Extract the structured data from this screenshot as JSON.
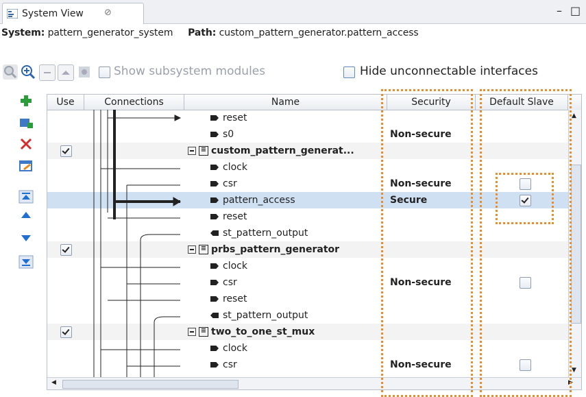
{
  "tab": {
    "title": "System View",
    "close": "⊘"
  },
  "window": {
    "minimize": "–",
    "maximize": "□"
  },
  "header": {
    "system_label": "System:",
    "system_value": "pattern_generator_system",
    "path_label": "Path:",
    "path_value": "custom_pattern_generator.pattern_access"
  },
  "toolbar": {
    "show_subsystem": {
      "label": "Show subsystem modules",
      "checked": false
    },
    "hide_unconnectable": {
      "label": "Hide unconnectable interfaces",
      "checked": false
    }
  },
  "columns": [
    "Use",
    "Connections",
    "Name",
    "Security",
    "Default Slave"
  ],
  "rows": [
    {
      "name": "reset",
      "kind": "pin",
      "security": "",
      "default": null,
      "trunc": "R"
    },
    {
      "name": "s0",
      "kind": "pin",
      "security": "Non-secure",
      "default": null,
      "trunc": "A"
    },
    {
      "name": "custom_pattern_generat...",
      "kind": "module",
      "use": true,
      "security": "",
      "default": null,
      "trunc": "C"
    },
    {
      "name": "clock",
      "kind": "pin",
      "security": "",
      "default": null,
      "trunc": "C"
    },
    {
      "name": "csr",
      "kind": "pin",
      "security": "Non-secure",
      "default": false,
      "trunc": "A"
    },
    {
      "name": "pattern_access",
      "kind": "pin",
      "security": "Secure",
      "default": true,
      "trunc": "A",
      "selected": true
    },
    {
      "name": "reset",
      "kind": "pin",
      "security": "",
      "default": null,
      "trunc": "R"
    },
    {
      "name": "st_pattern_output",
      "kind": "out",
      "security": "",
      "default": null,
      "trunc": "A"
    },
    {
      "name": "prbs_pattern_generator",
      "kind": "module",
      "use": true,
      "security": "",
      "default": null,
      "trunc": "P"
    },
    {
      "name": "clock",
      "kind": "pin",
      "security": "",
      "default": null,
      "trunc": "C"
    },
    {
      "name": "csr",
      "kind": "pin",
      "security": "Non-secure",
      "default": false,
      "trunc": "A"
    },
    {
      "name": "reset",
      "kind": "pin",
      "security": "",
      "default": null,
      "trunc": "R"
    },
    {
      "name": "st_pattern_output",
      "kind": "out",
      "security": "",
      "default": null,
      "trunc": "A"
    },
    {
      "name": "two_to_one_st_mux",
      "kind": "module",
      "use": true,
      "security": "",
      "default": null,
      "trunc": "T"
    },
    {
      "name": "clock",
      "kind": "pin",
      "security": "",
      "default": null,
      "trunc": "C"
    },
    {
      "name": "csr",
      "kind": "pin",
      "security": "Non-secure",
      "default": false,
      "trunc": "A"
    }
  ],
  "colors": {
    "highlight": "#e98d2c",
    "selection": "#cfe0f3"
  }
}
